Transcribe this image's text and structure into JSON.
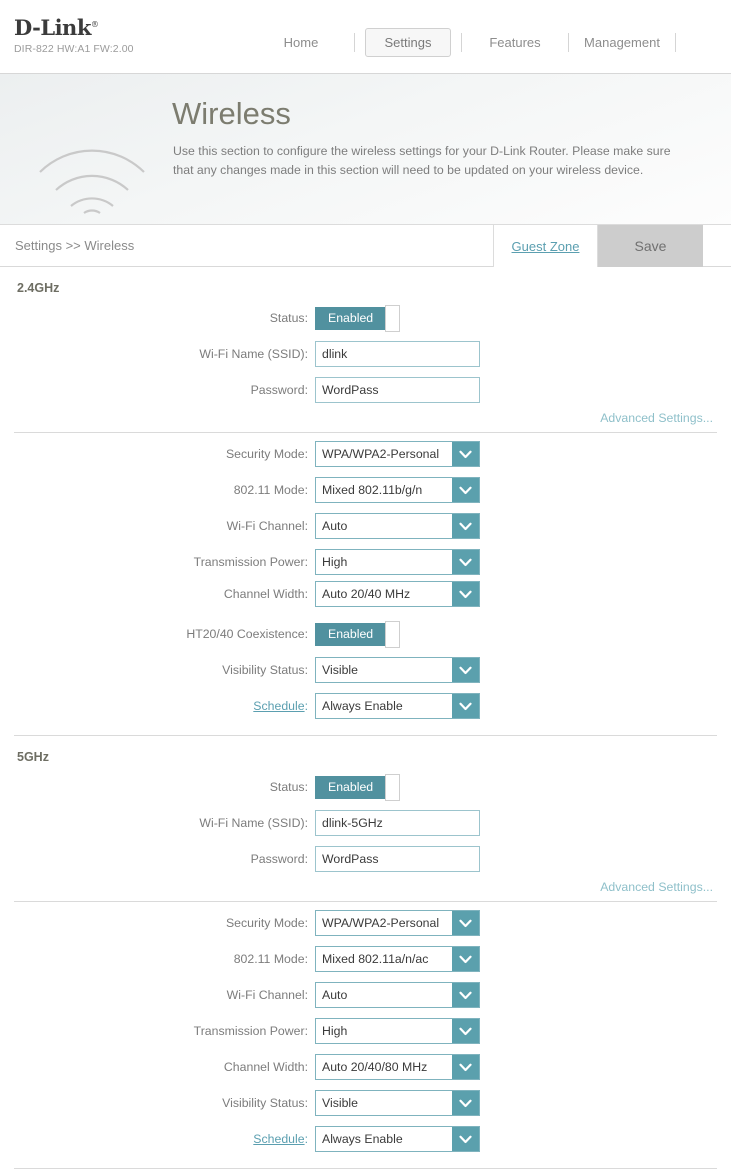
{
  "header": {
    "brand": "D-Link",
    "model": "DIR-822 HW:A1 FW:2.00",
    "nav": [
      {
        "label": "Home",
        "active": false
      },
      {
        "label": "Settings",
        "active": true
      },
      {
        "label": "Features",
        "active": false
      },
      {
        "label": "Management",
        "active": false
      }
    ]
  },
  "hero": {
    "icon": "wifi-icon",
    "title": "Wireless",
    "description": "Use this section to configure the wireless settings for your D-Link Router. Please make sure that any changes made in this section will need to be updated on your wireless device."
  },
  "crumbbar": {
    "breadcrumb": "Settings >> Wireless",
    "guest_zone_label": "Guest Zone",
    "save_label": "Save"
  },
  "advanced_link_label": "Advanced Settings...",
  "bands": [
    {
      "title": "2.4GHz",
      "basic": [
        {
          "label": "Status:",
          "type": "toggle",
          "value": "Enabled",
          "name": "status-toggle-24"
        },
        {
          "label": "Wi-Fi Name (SSID):",
          "type": "text",
          "value": "dlink",
          "placeholder": "",
          "name": "ssid-input-24"
        },
        {
          "label": "Password:",
          "type": "text",
          "value": "WordPass",
          "placeholder": "",
          "name": "password-input-24"
        }
      ],
      "advanced": [
        {
          "label": "Security Mode:",
          "type": "select",
          "value": "WPA/WPA2-Personal",
          "name": "security-mode-select-24"
        },
        {
          "label": "802.11 Mode:",
          "type": "select",
          "value": "Mixed 802.11b/g/n",
          "name": "dot11-mode-select-24"
        },
        {
          "label": "Wi-Fi Channel:",
          "type": "select",
          "value": "Auto",
          "name": "wifi-channel-select-24"
        },
        {
          "label": "Transmission Power:",
          "type": "select",
          "value": "High",
          "name": "transmission-power-select-24"
        },
        {
          "label": "Channel Width:",
          "type": "select",
          "value": "Auto 20/40 MHz",
          "name": "channel-width-select-24",
          "clipped": true
        },
        {
          "label": "HT20/40 Coexistence:",
          "type": "toggle",
          "value": "Enabled",
          "name": "ht2040-coexistence-toggle"
        },
        {
          "label": "Visibility Status:",
          "type": "select",
          "value": "Visible",
          "name": "visibility-status-select-24"
        },
        {
          "label": "Schedule:",
          "type": "select",
          "value": "Always Enable",
          "name": "schedule-select-24",
          "link": true
        }
      ]
    },
    {
      "title": "5GHz",
      "basic": [
        {
          "label": "Status:",
          "type": "toggle",
          "value": "Enabled",
          "name": "status-toggle-5"
        },
        {
          "label": "Wi-Fi Name (SSID):",
          "type": "text",
          "value": "dlink-5GHz",
          "placeholder": "",
          "name": "ssid-input-5"
        },
        {
          "label": "Password:",
          "type": "text",
          "value": "WordPass",
          "placeholder": "",
          "name": "password-input-5"
        }
      ],
      "advanced": [
        {
          "label": "Security Mode:",
          "type": "select",
          "value": "WPA/WPA2-Personal",
          "name": "security-mode-select-5"
        },
        {
          "label": "802.11 Mode:",
          "type": "select",
          "value": "Mixed 802.11a/n/ac",
          "name": "dot11-mode-select-5"
        },
        {
          "label": "Wi-Fi Channel:",
          "type": "select",
          "value": "Auto",
          "name": "wifi-channel-select-5"
        },
        {
          "label": "Transmission Power:",
          "type": "select",
          "value": "High",
          "name": "transmission-power-select-5"
        },
        {
          "label": "Channel Width:",
          "type": "select",
          "value": "Auto 20/40/80 MHz",
          "name": "channel-width-select-5"
        },
        {
          "label": "Visibility Status:",
          "type": "select",
          "value": "Visible",
          "name": "visibility-status-select-5"
        },
        {
          "label": "Schedule:",
          "type": "select",
          "value": "Always Enable",
          "name": "schedule-select-5",
          "link": true
        }
      ]
    }
  ],
  "colors": {
    "accent_teal": "#5ba0ad",
    "toggle_on": "#51919f",
    "save_bg": "#cdcdcd",
    "link": "#5b9fb0"
  }
}
